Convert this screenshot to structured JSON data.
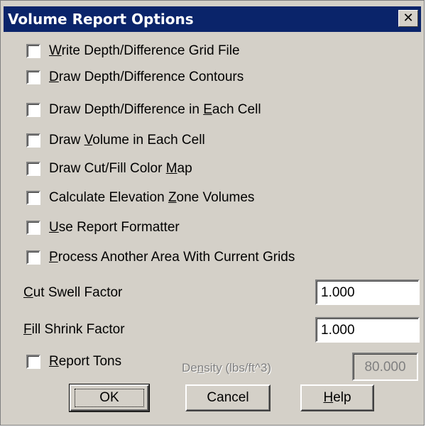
{
  "dialog": {
    "title": "Volume Report Options",
    "close_glyph": "✕"
  },
  "options": [
    {
      "pre": "",
      "u": "W",
      "post": "rite Depth/Difference Grid File",
      "checked": false
    },
    {
      "pre": "",
      "u": "D",
      "post": "raw Depth/Difference Contours",
      "checked": false
    },
    {
      "pre": "Draw Depth/Difference in ",
      "u": "E",
      "post": "ach Cell",
      "checked": false
    },
    {
      "pre": "Draw ",
      "u": "V",
      "post": "olume in Each Cell",
      "checked": false
    },
    {
      "pre": "Draw Cut/Fill Color ",
      "u": "M",
      "post": "ap",
      "checked": false
    },
    {
      "pre": "Calculate Elevation ",
      "u": "Z",
      "post": "one Volumes",
      "checked": false
    },
    {
      "pre": "",
      "u": "U",
      "post": "se Report Formatter",
      "checked": false
    },
    {
      "pre": "",
      "u": "P",
      "post": "rocess Another Area With Current Grids",
      "checked": false
    }
  ],
  "cut_swell": {
    "pre": "",
    "u": "C",
    "post": "ut Swell Factor",
    "value": "1.000"
  },
  "fill_shrink": {
    "pre": "",
    "u": "F",
    "post": "ill Shrink Factor",
    "value": "1.000"
  },
  "report_tons": {
    "pre": "",
    "u": "R",
    "post": "eport Tons",
    "checked": false
  },
  "density": {
    "pre": "De",
    "u": "n",
    "post": "sity (lbs/ft^3)",
    "value": "80.000"
  },
  "buttons": {
    "ok": "OK",
    "cancel": "Cancel",
    "help_u": "H",
    "help_post": "elp"
  }
}
